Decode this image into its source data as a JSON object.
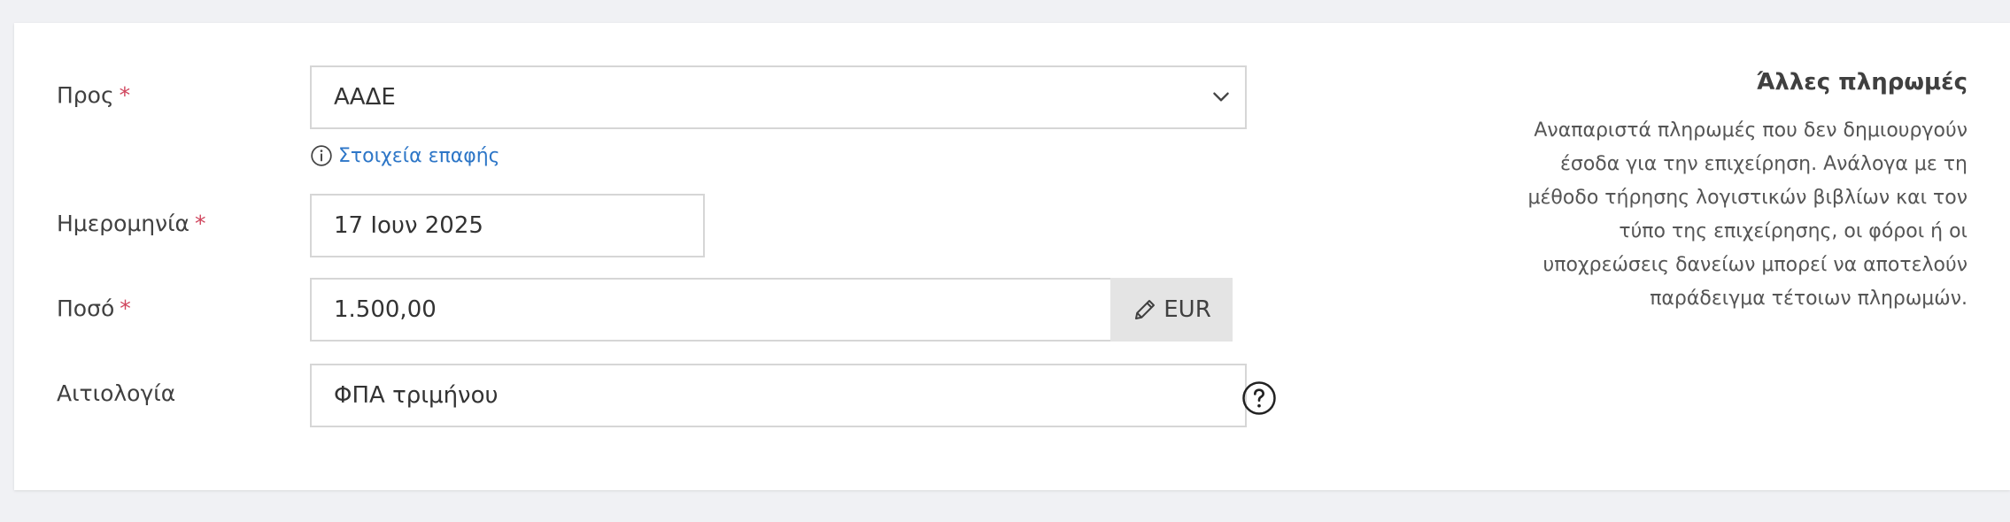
{
  "form": {
    "to_label": "Προς",
    "required_mark": "*",
    "to_value": "ΑΑΔΕ",
    "contact_link": "Στοιχεία επαφής",
    "date_label": "Ημερομηνία",
    "date_value": "17 Ιουν 2025",
    "amount_label": "Ποσό",
    "amount_value": "1.500,00",
    "currency": "EUR",
    "reason_label": "Αιτιολογία",
    "reason_value": "ΦΠΑ τριμήνου"
  },
  "sidebar": {
    "title": "Άλλες πληρωμές",
    "description_lines": [
      "Αναπαριστά πληρωμές που δεν δημιουργούν",
      "έσοδα για την επιχείρηση. Ανάλογα με τη",
      "μέθοδο τήρησης λογιστικών βιβλίων και τον",
      "τύπο της επιχείρησης, οι φόροι ή οι",
      "υποχρεώσεις δανείων μπορεί να αποτελούν",
      "παράδειγμα τέτοιων πληρωμών."
    ]
  },
  "icons": {
    "dropdown": "chevron-down-icon",
    "info": "info-icon",
    "edit": "pencil-icon",
    "help": "help-icon"
  },
  "colors": {
    "required": "#d0455d",
    "link": "#2d76c7",
    "page_bg": "#f0f1f4",
    "border": "#d6d6d6",
    "addon_bg": "#e4e4e4"
  }
}
